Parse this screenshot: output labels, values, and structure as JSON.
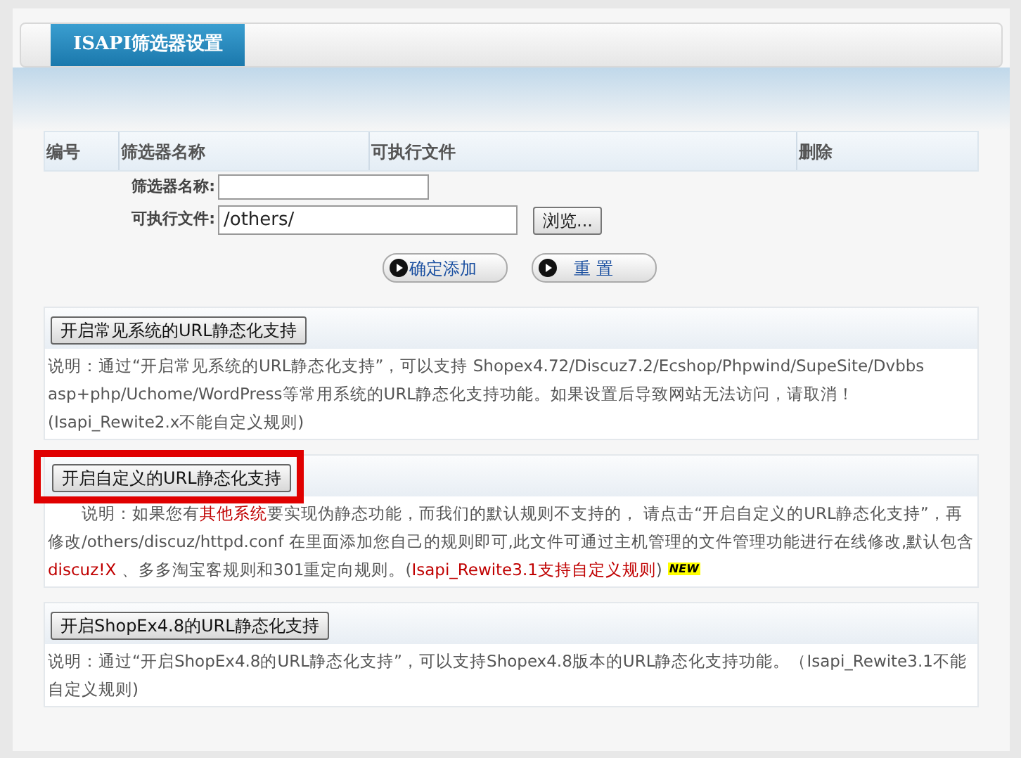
{
  "tab": {
    "label": "ISAPI筛选器设置"
  },
  "table": {
    "columns": [
      "编号",
      "筛选器名称",
      "可执行文件",
      "删除"
    ]
  },
  "form": {
    "fields": [
      {
        "label": "筛选器名称:"
      },
      {
        "label": "可执行文件:",
        "value": "/others/",
        "browse": "浏览..."
      }
    ],
    "actions": [
      "确定添加",
      "重 置"
    ]
  },
  "sections": [
    {
      "button": "开启常见系统的URL静态化支持",
      "highlighted": false,
      "indent": false,
      "description": [
        {
          "text": "说明：通过“开启常见系统的URL静态化支持”，可以支持 Shopex4.72/Discuz7.2/Ecshop/Phpwind/SupeSite/Dvbbs asp+php/Uchome/WordPress等常用系统的URL静态化支持功能。如果设置后导致网站无法访问，请取消！(Isapi_Rewite2.x不能自定义规则)",
          "emphasis": false
        }
      ]
    },
    {
      "button": "开启自定义的URL静态化支持",
      "highlighted": true,
      "indent": true,
      "description": [
        {
          "text": "说明：如果您有",
          "emphasis": false
        },
        {
          "text": "其他系统",
          "emphasis": true
        },
        {
          "text": "要实现伪静态功能，而我们的默认规则不支持的， 请点击“开启自定义的URL静态化支持”，再修改/others/discuz/httpd.conf 在里面添加您自己的规则即可,此文件可通过主机管理的文件管理功能进行在线修改,默认包含",
          "emphasis": false
        },
        {
          "text": "discuz!X",
          "emphasis": true
        },
        {
          "text": " 、多多淘宝客规则和301重定向规则。(",
          "emphasis": false
        },
        {
          "text": "Isapi_Rewite3.1支持自定义规则",
          "emphasis": true
        },
        {
          "text": ")",
          "emphasis": false
        }
      ],
      "badge": "NEW"
    },
    {
      "button": "开启ShopEx4.8的URL静态化支持",
      "highlighted": false,
      "indent": false,
      "description": [
        {
          "text": "说明：通过“开启ShopEx4.8的URL静态化支持”，可以支持Shopex4.8版本的URL静态化支持功能。（Isapi_Rewite3.1不能自定义规则)",
          "emphasis": false
        }
      ]
    }
  ]
}
